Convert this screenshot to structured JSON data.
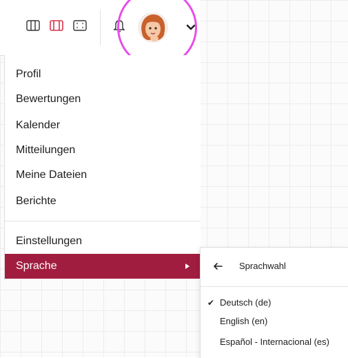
{
  "user_menu": {
    "items": [
      {
        "label": "Profil"
      },
      {
        "label": "Bewertungen"
      },
      {
        "label": "Kalender"
      },
      {
        "label": "Mitteilungen"
      },
      {
        "label": "Meine Dateien"
      },
      {
        "label": "Berichte"
      },
      {
        "label": "Einstellungen"
      },
      {
        "label": "Sprache"
      }
    ],
    "active_item": "Sprache",
    "active_color": "#a11d3f"
  },
  "language_submenu": {
    "title": "Sprachwahl",
    "back_icon": "arrow-left-icon",
    "languages": [
      {
        "label": "Deutsch (de)",
        "selected": true
      },
      {
        "label": "English (en)",
        "selected": false
      },
      {
        "label": "Español - Internacional (es)",
        "selected": false
      }
    ],
    "check_glyph": "✔"
  },
  "toolbar": {
    "icons": [
      "columns-icon",
      "split-view-icon",
      "fullscreen-icon",
      "bell-icon",
      "avatar",
      "chevron-down-icon"
    ],
    "accent_color": "#d6344b"
  },
  "annotation": {
    "highlight_color": "#e84de8"
  }
}
